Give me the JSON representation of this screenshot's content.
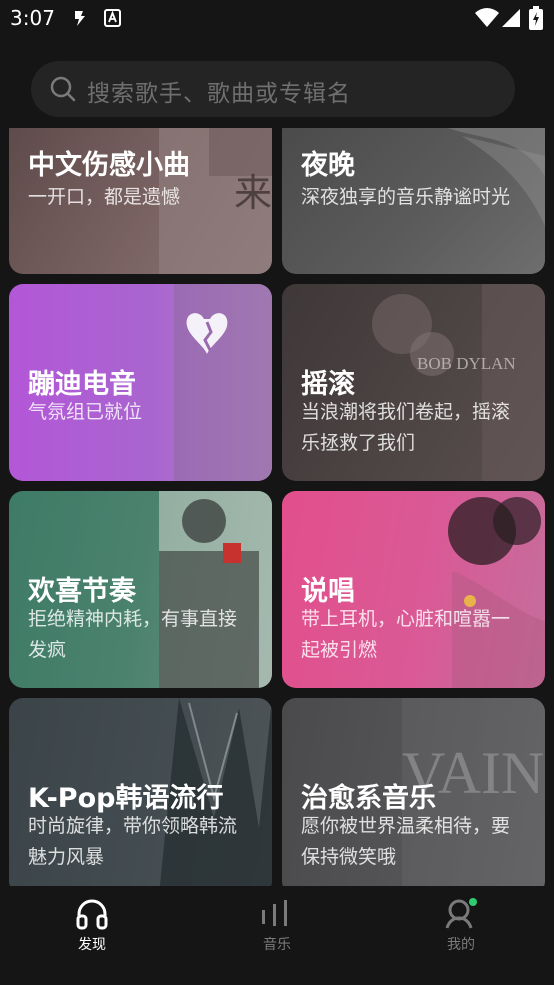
{
  "status": {
    "time": "3:07"
  },
  "search": {
    "placeholder": "搜索歌手、歌曲或专辑名"
  },
  "cards": [
    {
      "title": "中文伤感小曲",
      "subtitle": "一开口，都是遗憾",
      "art_text": "来"
    },
    {
      "title": "夜晚",
      "subtitle": "深夜独享的音乐静谧时光"
    },
    {
      "title": "蹦迪电音",
      "subtitle": "气氛组已就位"
    },
    {
      "title": "摇滚",
      "subtitle": "当浪潮将我们卷起，摇滚乐拯救了我们",
      "art_text": "BOB DYLAN"
    },
    {
      "title": "欢喜节奏",
      "subtitle": "拒绝精神内耗，有事直接发疯"
    },
    {
      "title": "说唱",
      "subtitle": "带上耳机，心脏和喧嚣一起被引燃"
    },
    {
      "title": "K-Pop韩语流行",
      "subtitle": "时尚旋律，带你领略韩流魅力风暴"
    },
    {
      "title": "治愈系音乐",
      "subtitle": "愿你被世界温柔相待，要保持微笑哦",
      "art_text": "VAIN"
    }
  ],
  "nav": [
    {
      "label": "发现",
      "icon": "headphones-icon",
      "active": true
    },
    {
      "label": "音乐",
      "icon": "music-bars-icon",
      "active": false
    },
    {
      "label": "我的",
      "icon": "profile-icon",
      "active": false,
      "badge_color": "#2ecc71"
    }
  ],
  "colors": {
    "background": "#151515",
    "search_bg": "#242424",
    "active_nav": "#ffffff",
    "inactive_nav": "#7a7a7a"
  }
}
